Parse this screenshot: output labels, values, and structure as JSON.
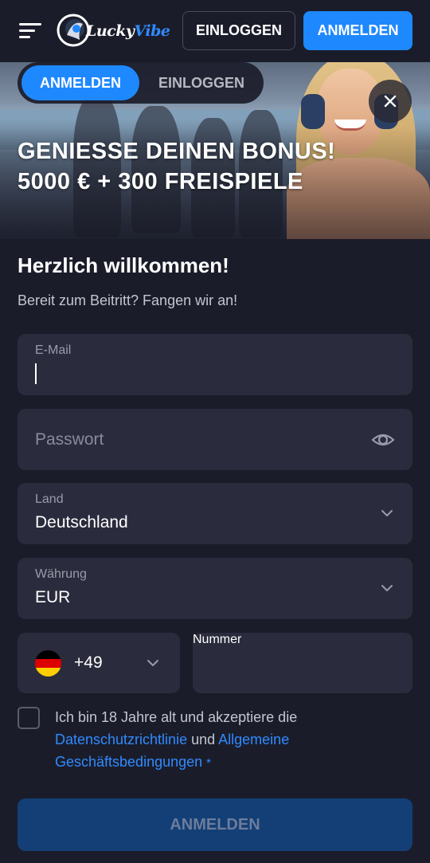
{
  "header": {
    "logo_word1": "Lucky",
    "logo_word2": "Vibe",
    "login_label": "EINLOGGEN",
    "register_label": "ANMELDEN"
  },
  "banner": {
    "tab_register": "ANMELDEN",
    "tab_login": "EINLOGGEN",
    "bonus_line1": "GENIESSE DEINEN BONUS!",
    "bonus_line2": "5000 € + 300 FREISPIELE"
  },
  "form": {
    "welcome": "Herzlich willkommen!",
    "subtitle": "Bereit zum Beitritt? Fangen wir an!",
    "email_label": "E-Mail",
    "email_value": "",
    "password_placeholder": "Passwort",
    "country_label": "Land",
    "country_value": "Deutschland",
    "currency_label": "Währung",
    "currency_value": "EUR",
    "phone_code": "+49",
    "phone_placeholder": "Nummer",
    "terms_text": "Ich bin 18 Jahre alt und akzeptiere die",
    "terms_privacy": "Datenschutzrichtlinie",
    "terms_and": "und",
    "terms_general": "Allgemeine",
    "terms_conditions": "Geschäftsbedingungen",
    "terms_required": "*",
    "submit_label": "ANMELDEN"
  },
  "colors": {
    "background": "#1b1c2a",
    "field": "#2a2b3c",
    "accent": "#1e88ff",
    "link": "#2f8bff",
    "submit_disabled": "#133f76"
  },
  "icons": [
    "menu-icon",
    "logo-icon",
    "close-icon",
    "eye-icon",
    "chevron-down-icon",
    "germany-flag-icon"
  ]
}
